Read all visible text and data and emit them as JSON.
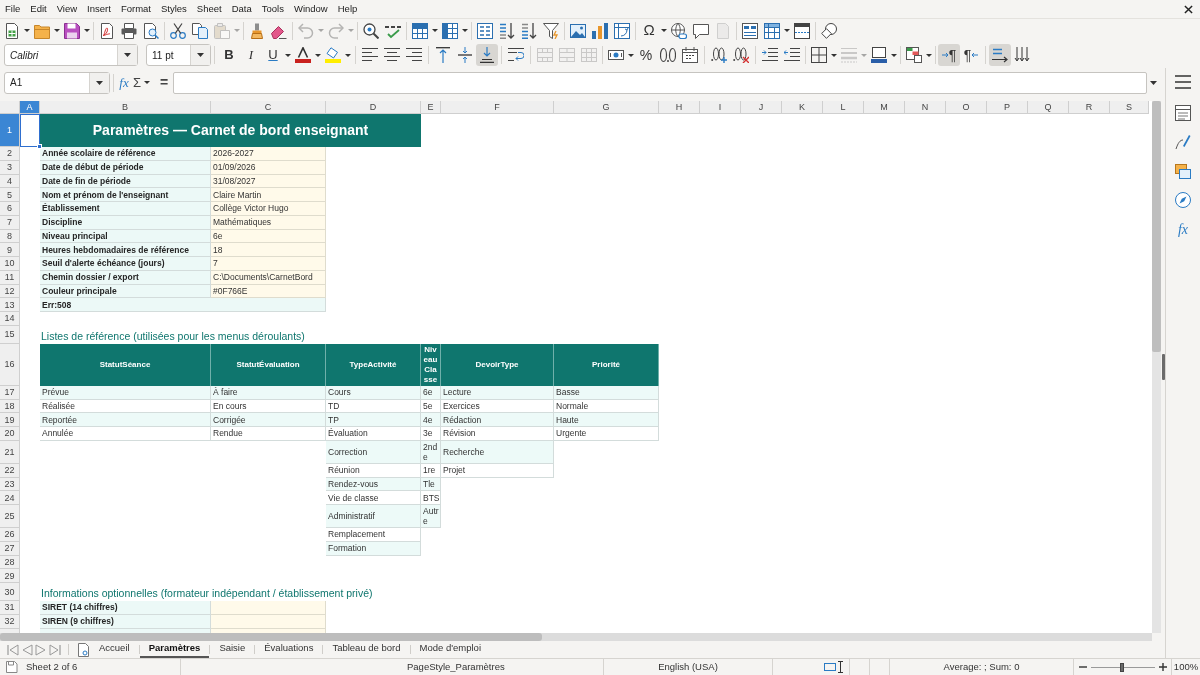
{
  "menu_bar": {
    "items": [
      "File",
      "Edit",
      "View",
      "Insert",
      "Format",
      "Styles",
      "Sheet",
      "Data",
      "Tools",
      "Window",
      "Help"
    ]
  },
  "standard_toolbar": {
    "paste": {
      "disabled": true
    },
    "undo": {
      "disabled": true
    },
    "redo": {
      "disabled": true
    },
    "special_character": "Ω",
    "headers_footers": {
      "disabled": true
    }
  },
  "formatting_toolbar": {
    "font_name": "Calibri",
    "font_size": "11 pt",
    "bold": "B",
    "italic": "I",
    "underline": "U",
    "align_bottom": {
      "pressed": true
    },
    "merge_cells": {
      "disabled": true
    },
    "percent": "%",
    "border_style": {
      "disabled": true
    },
    "paragraph_ltr": {
      "glyph": "¶",
      "pressed": true
    },
    "paragraph_rtl": {
      "glyph": "¶",
      "pressed": false
    },
    "text_ltr": {
      "pressed": true
    }
  },
  "formula_bar": {
    "name_box": "A1",
    "function_wizard": "fx",
    "sum": "Σ",
    "formula_button": "="
  },
  "sheet": {
    "columns": [
      {
        "label": "A",
        "selected": true
      },
      {
        "label": "B",
        "selected": false
      },
      {
        "label": "C",
        "selected": false
      },
      {
        "label": "D",
        "selected": false
      },
      {
        "label": "E",
        "selected": false
      },
      {
        "label": "F",
        "selected": false
      },
      {
        "label": "G",
        "selected": false
      },
      {
        "label": "H",
        "selected": false
      },
      {
        "label": "I",
        "selected": false
      },
      {
        "label": "J",
        "selected": false
      },
      {
        "label": "K",
        "selected": false
      },
      {
        "label": "L",
        "selected": false
      },
      {
        "label": "M",
        "selected": false
      },
      {
        "label": "N",
        "selected": false
      },
      {
        "label": "O",
        "selected": false
      },
      {
        "label": "P",
        "selected": false
      },
      {
        "label": "Q",
        "selected": false
      },
      {
        "label": "R",
        "selected": false
      },
      {
        "label": "S",
        "selected": false
      }
    ],
    "rows": [
      {
        "label": "1",
        "selected": true,
        "cells": [
          {
            "kind": "blank"
          },
          {
            "kind": "title",
            "text": "Paramètres — Carnet de bord enseignant"
          },
          {
            "kind": "merged"
          },
          {
            "kind": "merged"
          }
        ]
      },
      {
        "label": "2",
        "selected": false,
        "cells": [
          {
            "kind": "blank"
          },
          {
            "kind": "label",
            "text": "Année scolaire de référence"
          },
          {
            "kind": "value",
            "text": "2026-2027"
          }
        ]
      },
      {
        "label": "3",
        "selected": false,
        "cells": [
          {
            "kind": "blank"
          },
          {
            "kind": "label",
            "text": "Date de début de période"
          },
          {
            "kind": "value",
            "text": "01/09/2026"
          }
        ]
      },
      {
        "label": "4",
        "selected": false,
        "cells": [
          {
            "kind": "blank"
          },
          {
            "kind": "label",
            "text": "Date de fin de période"
          },
          {
            "kind": "value",
            "text": "31/08/2027"
          }
        ]
      },
      {
        "label": "5",
        "selected": false,
        "cells": [
          {
            "kind": "blank"
          },
          {
            "kind": "label",
            "text": "Nom et prénom de l'enseignant"
          },
          {
            "kind": "value",
            "text": "Claire Martin"
          }
        ]
      },
      {
        "label": "6",
        "selected": false,
        "cells": [
          {
            "kind": "blank"
          },
          {
            "kind": "label",
            "text": "Établissement"
          },
          {
            "kind": "value",
            "text": "Collège Victor Hugo"
          }
        ]
      },
      {
        "label": "7",
        "selected": false,
        "cells": [
          {
            "kind": "blank"
          },
          {
            "kind": "label",
            "text": "Discipline"
          },
          {
            "kind": "value",
            "text": "Mathématiques"
          }
        ]
      },
      {
        "label": "8",
        "selected": false,
        "cells": [
          {
            "kind": "blank"
          },
          {
            "kind": "label",
            "text": "Niveau principal"
          },
          {
            "kind": "value",
            "text": "6e"
          }
        ]
      },
      {
        "label": "9",
        "selected": false,
        "cells": [
          {
            "kind": "blank"
          },
          {
            "kind": "label",
            "text": "Heures hebdomadaires de référence"
          },
          {
            "kind": "value",
            "text": "18"
          }
        ]
      },
      {
        "label": "10",
        "selected": false,
        "cells": [
          {
            "kind": "blank"
          },
          {
            "kind": "label",
            "text": "Seuil d'alerte échéance (jours)"
          },
          {
            "kind": "value",
            "text": "7"
          }
        ]
      },
      {
        "label": "11",
        "selected": false,
        "cells": [
          {
            "kind": "blank"
          },
          {
            "kind": "label",
            "text": "Chemin dossier / export"
          },
          {
            "kind": "value",
            "text": "C:\\Documents\\CarnetBord"
          }
        ]
      },
      {
        "label": "12",
        "selected": false,
        "cells": [
          {
            "kind": "blank"
          },
          {
            "kind": "label",
            "text": "Couleur principale"
          },
          {
            "kind": "value",
            "text": "#0F766E"
          }
        ]
      },
      {
        "label": "13",
        "selected": false,
        "cells": [
          {
            "kind": "blank"
          },
          {
            "kind": "error",
            "text": "Err:508"
          },
          {
            "kind": "merged"
          }
        ]
      },
      {
        "label": "14",
        "selected": false
      },
      {
        "label": "15",
        "selected": false,
        "cells": [
          {
            "kind": "blank"
          },
          {
            "kind": "section",
            "text": "Listes de référence (utilisées pour les menus déroulants)"
          }
        ]
      },
      {
        "label": "16",
        "selected": false,
        "cells": [
          {
            "kind": "blank"
          },
          {
            "kind": "list_header",
            "text": "StatutSéance"
          },
          {
            "kind": "list_header",
            "text": "StatutÉvaluation"
          },
          {
            "kind": "list_header",
            "text": "TypeActivité"
          },
          {
            "kind": "list_header",
            "text": "NiveauClasse"
          },
          {
            "kind": "list_header",
            "text": "DevoirType"
          },
          {
            "kind": "list_header",
            "text": "Priorité"
          }
        ]
      },
      {
        "label": "17",
        "selected": false,
        "cells": [
          {
            "kind": "blank"
          },
          {
            "kind": "list_item",
            "text": "Prévue",
            "shaded": true
          },
          {
            "kind": "list_item",
            "text": "À faire",
            "shaded": true
          },
          {
            "kind": "list_item",
            "text": "Cours",
            "shaded": true
          },
          {
            "kind": "list_item",
            "text": "6e",
            "shaded": true
          },
          {
            "kind": "list_item",
            "text": "Lecture",
            "shaded": true
          },
          {
            "kind": "list_item",
            "text": "Basse",
            "shaded": true
          }
        ]
      },
      {
        "label": "18",
        "selected": false,
        "cells": [
          {
            "kind": "blank"
          },
          {
            "kind": "list_item",
            "text": "Réalisée",
            "shaded": false
          },
          {
            "kind": "list_item",
            "text": "En cours",
            "shaded": false
          },
          {
            "kind": "list_item",
            "text": "TD",
            "shaded": false
          },
          {
            "kind": "list_item",
            "text": "5e",
            "shaded": false
          },
          {
            "kind": "list_item",
            "text": "Exercices",
            "shaded": false
          },
          {
            "kind": "list_item",
            "text": "Normale",
            "shaded": false
          }
        ]
      },
      {
        "label": "19",
        "selected": false,
        "cells": [
          {
            "kind": "blank"
          },
          {
            "kind": "list_item",
            "text": "Reportée",
            "shaded": true
          },
          {
            "kind": "list_item",
            "text": "Corrigée",
            "shaded": true
          },
          {
            "kind": "list_item",
            "text": "TP",
            "shaded": true
          },
          {
            "kind": "list_item",
            "text": "4e",
            "shaded": true
          },
          {
            "kind": "list_item",
            "text": "Rédaction",
            "shaded": true
          },
          {
            "kind": "list_item",
            "text": "Haute",
            "shaded": true
          }
        ]
      },
      {
        "label": "20",
        "selected": false,
        "cells": [
          {
            "kind": "blank"
          },
          {
            "kind": "list_item",
            "text": "Annulée",
            "shaded": false
          },
          {
            "kind": "list_item",
            "text": "Rendue",
            "shaded": false
          },
          {
            "kind": "list_item",
            "text": "Évaluation",
            "shaded": false
          },
          {
            "kind": "list_item",
            "text": "3e",
            "shaded": false
          },
          {
            "kind": "list_item",
            "text": "Révision",
            "shaded": false
          },
          {
            "kind": "list_item",
            "text": "Urgente",
            "shaded": false
          }
        ]
      },
      {
        "label": "21",
        "selected": false,
        "cells": [
          {
            "kind": "blank"
          },
          {
            "kind": "blank"
          },
          {
            "kind": "blank"
          },
          {
            "kind": "list_item",
            "text": "Correction",
            "shaded": true
          },
          {
            "kind": "list_item",
            "text": "2nde",
            "shaded": true
          },
          {
            "kind": "list_item",
            "text": "Recherche",
            "shaded": true
          }
        ]
      },
      {
        "label": "22",
        "selected": false,
        "cells": [
          {
            "kind": "blank"
          },
          {
            "kind": "blank"
          },
          {
            "kind": "blank"
          },
          {
            "kind": "list_item",
            "text": "Réunion",
            "shaded": false
          },
          {
            "kind": "list_item",
            "text": "1re",
            "shaded": false
          },
          {
            "kind": "list_item",
            "text": "Projet",
            "shaded": false
          }
        ]
      },
      {
        "label": "23",
        "selected": false,
        "cells": [
          {
            "kind": "blank"
          },
          {
            "kind": "blank"
          },
          {
            "kind": "blank"
          },
          {
            "kind": "list_item",
            "text": "Rendez-vous",
            "shaded": true
          },
          {
            "kind": "list_item",
            "text": "Tle",
            "shaded": true
          }
        ]
      },
      {
        "label": "24",
        "selected": false,
        "cells": [
          {
            "kind": "blank"
          },
          {
            "kind": "blank"
          },
          {
            "kind": "blank"
          },
          {
            "kind": "list_item",
            "text": "Vie de classe",
            "shaded": false
          },
          {
            "kind": "list_item",
            "text": "BTS",
            "shaded": false
          }
        ]
      },
      {
        "label": "25",
        "selected": false,
        "cells": [
          {
            "kind": "blank"
          },
          {
            "kind": "blank"
          },
          {
            "kind": "blank"
          },
          {
            "kind": "list_item",
            "text": "Administratif",
            "shaded": true
          },
          {
            "kind": "list_item",
            "text": "Autre",
            "shaded": true
          }
        ]
      },
      {
        "label": "26",
        "selected": false,
        "cells": [
          {
            "kind": "blank"
          },
          {
            "kind": "blank"
          },
          {
            "kind": "blank"
          },
          {
            "kind": "list_item",
            "text": "Remplacement",
            "shaded": false
          }
        ]
      },
      {
        "label": "27",
        "selected": false,
        "cells": [
          {
            "kind": "blank"
          },
          {
            "kind": "blank"
          },
          {
            "kind": "blank"
          },
          {
            "kind": "list_item",
            "text": "Formation",
            "shaded": true
          }
        ]
      },
      {
        "label": "28",
        "selected": false
      },
      {
        "label": "29",
        "selected": false
      },
      {
        "label": "30",
        "selected": false,
        "cells": [
          {
            "kind": "blank"
          },
          {
            "kind": "section",
            "text": "Informations optionnelles (formateur indépendant / établissement privé)"
          }
        ]
      },
      {
        "label": "31",
        "selected": false,
        "cells": [
          {
            "kind": "blank"
          },
          {
            "kind": "label",
            "text": "SIRET (14 chiffres)"
          },
          {
            "kind": "value"
          }
        ]
      },
      {
        "label": "32",
        "selected": false,
        "cells": [
          {
            "kind": "blank"
          },
          {
            "kind": "label",
            "text": "SIREN (9 chiffres)"
          },
          {
            "kind": "value"
          }
        ]
      },
      {
        "selected": false,
        "cells": [
          {
            "kind": "blank"
          },
          {
            "kind": "label"
          },
          {
            "kind": "value"
          }
        ]
      }
    ]
  },
  "sheet_tabs": [
    {
      "label": "Accueil",
      "selected": false
    },
    {
      "label": "Paramètres",
      "selected": true
    },
    {
      "label": "Saisie",
      "selected": false
    },
    {
      "label": "Évaluations",
      "selected": false
    },
    {
      "label": "Tableau de bord",
      "selected": false
    },
    {
      "label": "Mode d'emploi",
      "selected": false
    }
  ],
  "status_bar": {
    "sheet_position": "Sheet 2 of 6",
    "page_style": "PageStyle_Paramètres",
    "language": "English (USA)",
    "selection_summary": "Average: ; Sum: 0",
    "zoom": {
      "level": 0.48
    },
    "zoom_percent": "100%"
  },
  "sidebar": {
    "functions": "fx"
  }
}
